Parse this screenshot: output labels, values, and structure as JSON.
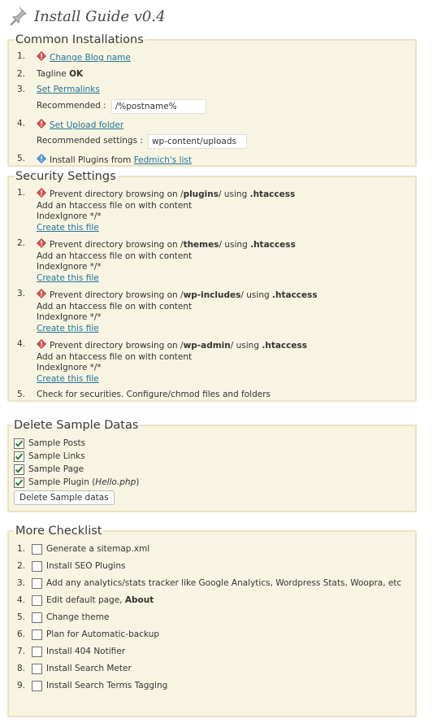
{
  "page": {
    "title": "Install Guide v0.4",
    "icons": {
      "header": "pin-icon",
      "alert": "red-alert-icon",
      "info": "blue-info-icon",
      "check": "checkmark-icon"
    }
  },
  "common": {
    "legend": "Common Installations",
    "items": [
      {
        "num": "1.",
        "link": "Change Blog name"
      },
      {
        "num": "2.",
        "text": "Tagline",
        "status": "OK"
      },
      {
        "num": "3.",
        "link": "Set Permalinks",
        "label": "Recommended :",
        "value": "/%postname%"
      },
      {
        "num": "4.",
        "link": "Set Upload folder",
        "label": "Recommended settings :",
        "value": "wp-content/uploads"
      },
      {
        "num": "5.",
        "text": "Install Plugins from",
        "link": "Fedmich's list"
      }
    ]
  },
  "security": {
    "legend": "Security Settings",
    "items": [
      {
        "num": "1.",
        "pre": "Prevent directory browsing on /",
        "dir": "plugins",
        "post": "/ using",
        "file": ".htaccess",
        "line2": "Add an htaccess file on with content",
        "line3": "IndexIgnore */*",
        "link": "Create this file"
      },
      {
        "num": "2.",
        "pre": "Prevent directory browsing on /",
        "dir": "themes",
        "post": "/ using",
        "file": ".htaccess",
        "line2": "Add an htaccess file on with content",
        "line3": "IndexIgnore */*",
        "link": "Create this file"
      },
      {
        "num": "3.",
        "pre": "Prevent directory browsing on /",
        "dir": "wp-includes",
        "post": "/ using",
        "file": ".htaccess",
        "line2": "Add an htaccess file on with content",
        "line3": "IndexIgnore */*",
        "link": "Create this file"
      },
      {
        "num": "4.",
        "pre": "Prevent directory browsing on /",
        "dir": "wp-admin",
        "post": "/ using",
        "file": ".htaccess",
        "line2": "Add an htaccess file on with content",
        "line3": "IndexIgnore */*",
        "link": "Create this file"
      },
      {
        "num": "5.",
        "text": "Check for securities. Configure/chmod files and folders"
      }
    ]
  },
  "samples": {
    "legend": "Delete Sample Datas",
    "items": [
      {
        "label": "Sample Posts",
        "checked": true
      },
      {
        "label": "Sample Links",
        "checked": true
      },
      {
        "label": "Sample Page",
        "checked": true
      },
      {
        "label": "Sample Plugin",
        "note": "Hello.php",
        "checked": true
      }
    ],
    "button": "Delete Sample datas"
  },
  "checklist": {
    "legend": "More Checklist",
    "items": [
      {
        "num": "1.",
        "text": "Generate a sitemap.xml"
      },
      {
        "num": "2.",
        "text": "Install SEO Plugins"
      },
      {
        "num": "3.",
        "text": "Add any analytics/stats tracker like Google Analytics, Wordpress Stats, Woopra, etc"
      },
      {
        "num": "4.",
        "text": "Edit default page,",
        "bold": "About"
      },
      {
        "num": "5.",
        "text": "Change theme"
      },
      {
        "num": "6.",
        "text": "Plan for Automatic-backup"
      },
      {
        "num": "7.",
        "text": "Install 404 Notifier"
      },
      {
        "num": "8.",
        "text": "Install Search Meter"
      },
      {
        "num": "9.",
        "text": "Install Search Terms Tagging"
      }
    ]
  }
}
